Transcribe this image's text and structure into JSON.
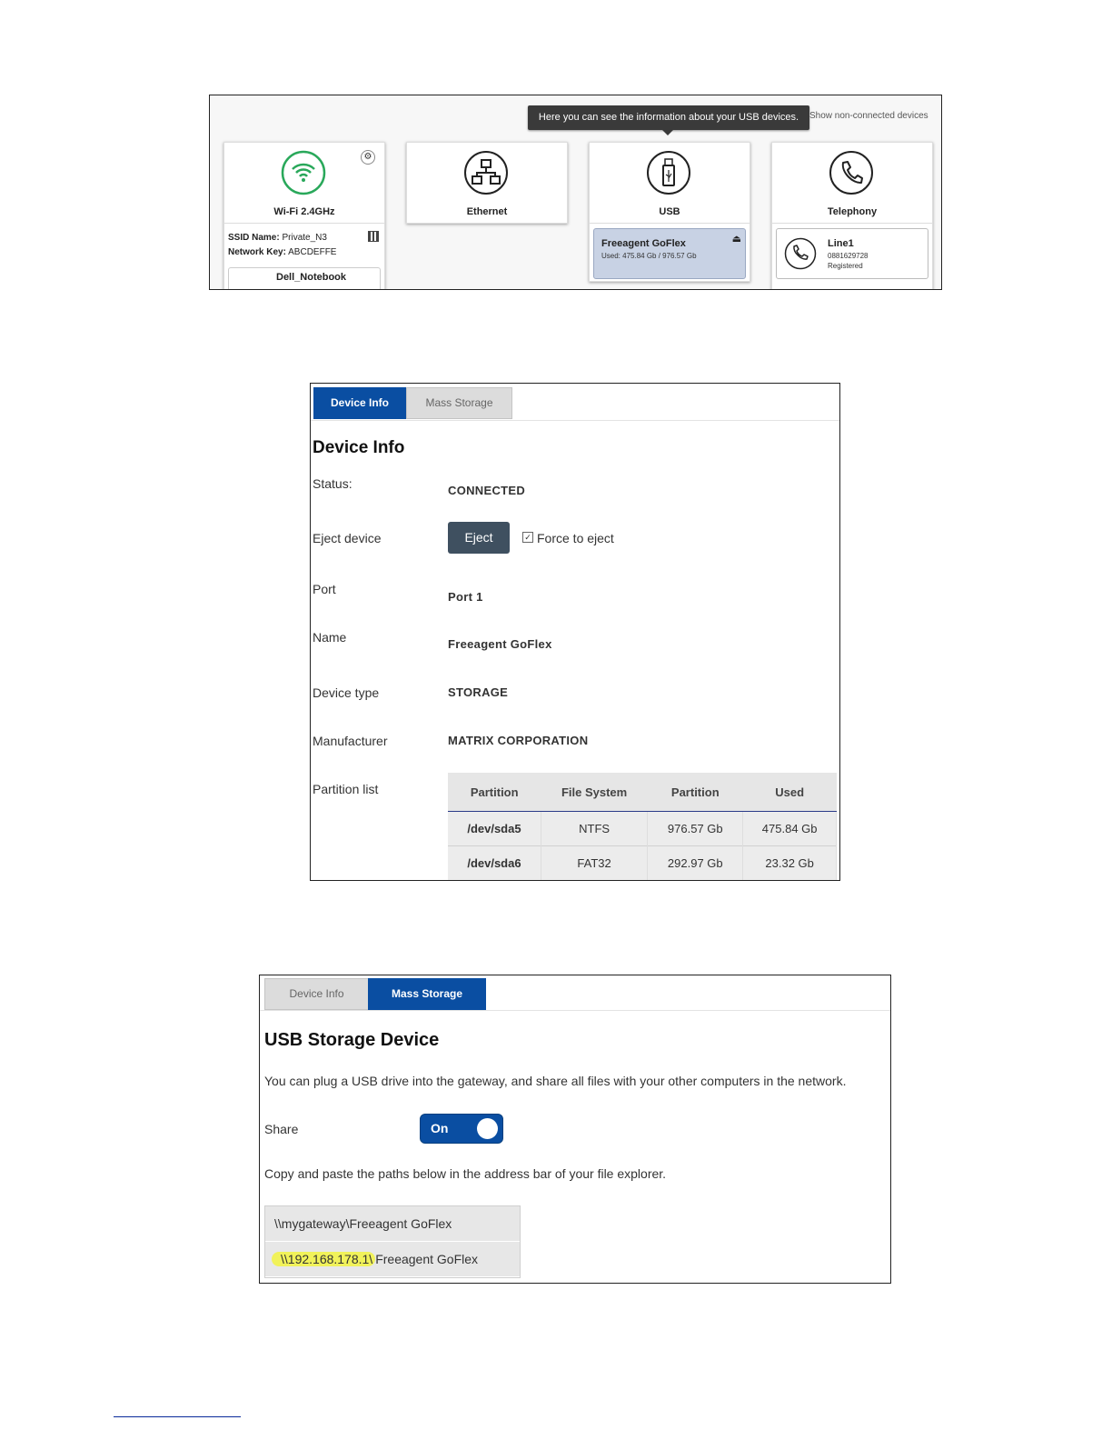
{
  "dashboard": {
    "tooltip": "Here you can see the information about your USB devices.",
    "show_link": "Show non-connected devices",
    "cards": {
      "wifi": {
        "label": "Wi-Fi 2.4GHz",
        "ssid_key": "SSID Name:",
        "ssid_value": "Private_N3",
        "netkey_key": "Network Key:",
        "netkey_value": "ABCDEFFE",
        "client_name": "Dell_Notebook"
      },
      "ethernet": {
        "label": "Ethernet"
      },
      "usb": {
        "label": "USB",
        "device_name": "Freeagent GoFlex",
        "device_usage": "Used: 475.84 Gb / 976.57 Gb"
      },
      "telephony": {
        "label": "Telephony",
        "line_name": "Line1",
        "line_number": "0881629728",
        "line_status": "Registered"
      }
    },
    "colors": {
      "wifi_green": "#29a85a"
    }
  },
  "device_info": {
    "tabs": [
      "Device Info",
      "Mass Storage"
    ],
    "heading": "Device Info",
    "status_label": "Status:",
    "status_value": "CONNECTED",
    "eject_label": "Eject device",
    "eject_button": "Eject",
    "force_eject": "Force to eject",
    "port_label": "Port",
    "port_value": "Port 1",
    "name_label": "Name",
    "name_value": "Freeagent GoFlex",
    "type_label": "Device type",
    "type_value": "STORAGE",
    "manufacturer_label": "Manufacturer",
    "manufacturer_value": "MATRIX CORPORATION",
    "partition_label": "Partition list",
    "partition_table": {
      "headers": [
        "Partition",
        "File System",
        "Partition",
        "Used"
      ],
      "rows": [
        [
          "/dev/sda5",
          "NTFS",
          "976.57 Gb",
          "475.84 Gb"
        ],
        [
          "/dev/sda6",
          "FAT32",
          "292.97 Gb",
          "23.32 Gb"
        ]
      ]
    }
  },
  "mass_storage": {
    "tabs": [
      "Device Info",
      "Mass Storage"
    ],
    "heading": "USB Storage Device",
    "description": "You can plug a USB drive into the gateway, and share all files with your other computers in the network.",
    "share_label": "Share",
    "share_toggle": "On",
    "copy_hint": "Copy and paste the paths below in the address bar of your file explorer.",
    "path1": "\\\\mygateway\\Freeagent GoFlex",
    "path2_highlight": "\\\\192.168.178.1\\",
    "path2_rest": "Freeagent GoFlex",
    "colors": {
      "tab_active": "#0a4ea2",
      "highlight": "#f1f25a"
    }
  }
}
